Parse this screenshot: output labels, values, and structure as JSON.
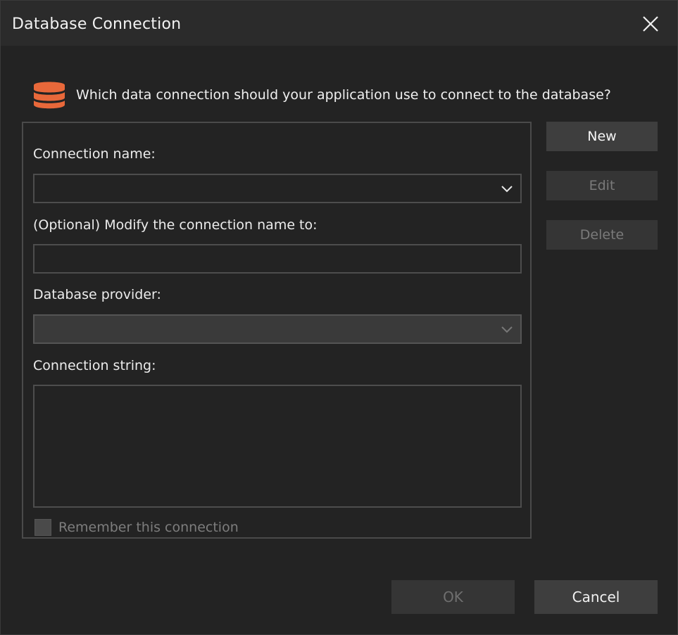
{
  "window": {
    "title": "Database Connection"
  },
  "header": {
    "question": "Which data connection should your application use to connect to the database?"
  },
  "form": {
    "connection_name_label": "Connection name:",
    "connection_name_value": "",
    "modify_name_label": "(Optional) Modify the connection name to:",
    "modify_name_value": "",
    "provider_label": "Database provider:",
    "provider_value": "",
    "connection_string_label": "Connection string:",
    "connection_string_value": "",
    "remember_label": "Remember this connection",
    "remember_checked": false
  },
  "side_buttons": {
    "new": "New",
    "edit": "Edit",
    "delete": "Delete"
  },
  "footer": {
    "ok": "OK",
    "cancel": "Cancel"
  },
  "icons": {
    "close": "close-icon",
    "database": "database-icon",
    "chevron": "chevron-down-icon"
  },
  "colors": {
    "accent": "#e8683a",
    "background": "#232323",
    "titlebar": "#2b2b2b"
  }
}
